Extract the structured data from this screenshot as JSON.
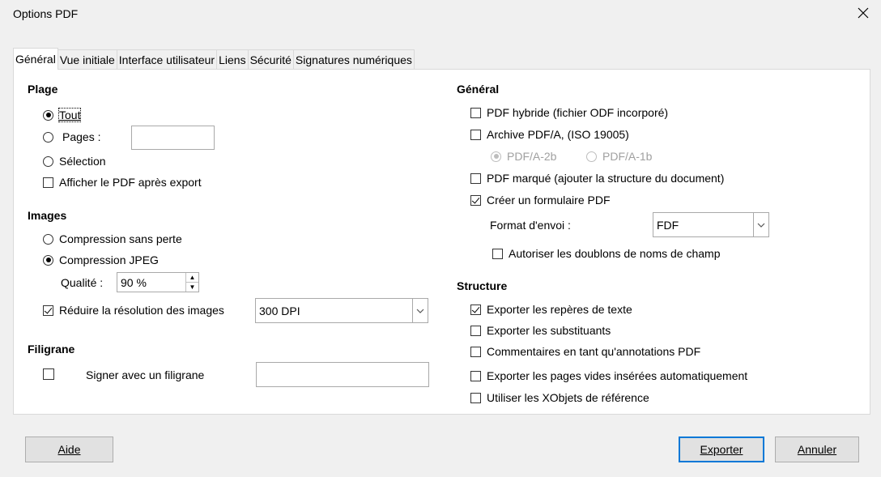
{
  "window": {
    "title": "Options PDF"
  },
  "tabs": [
    "Général",
    "Vue initiale",
    "Interface utilisateur",
    "Liens",
    "Sécurité",
    "Signatures numériques"
  ],
  "left": {
    "plage": {
      "heading": "Plage",
      "tout": "Tout",
      "pages": "Pages :",
      "pages_value": "",
      "selection": "Sélection",
      "afficher": "Afficher le PDF après export"
    },
    "images": {
      "heading": "Images",
      "lossless": "Compression sans perte",
      "jpeg": "Compression JPEG",
      "quality_label": "Qualité :",
      "quality_value": "90 %",
      "reduce_label": "Réduire la résolution des images",
      "reduce_value": "300 DPI"
    },
    "filigrane": {
      "heading": "Filigrane",
      "sign_label": "Signer avec un filigrane",
      "sign_value": ""
    }
  },
  "right": {
    "general": {
      "heading": "Général",
      "hybrid": "PDF hybride (fichier ODF incorporé)",
      "archive": "Archive PDF/A, (ISO 19005)",
      "pdfa2b": "PDF/A-2b",
      "pdfa1b": "PDF/A-1b",
      "tagged": "PDF marqué (ajouter la structure du document)",
      "form": "Créer un formulaire PDF",
      "format_label": "Format d'envoi :",
      "format_value": "FDF",
      "duplicates": "Autoriser les doublons de noms de champ"
    },
    "structure": {
      "heading": "Structure",
      "bookmarks": "Exporter les repères de texte",
      "placeholders": "Exporter les substituants",
      "comments": "Commentaires en tant qu'annotations PDF",
      "blank_pages": "Exporter les pages vides insérées automatiquement",
      "xobjects": "Utiliser les XObjets de référence"
    }
  },
  "buttons": {
    "help": "Aide",
    "export": "Exporter",
    "cancel": "Annuler"
  },
  "colors": {
    "accent": "#0078d7",
    "background": "#f0f0f0",
    "panel": "#ffffff"
  }
}
